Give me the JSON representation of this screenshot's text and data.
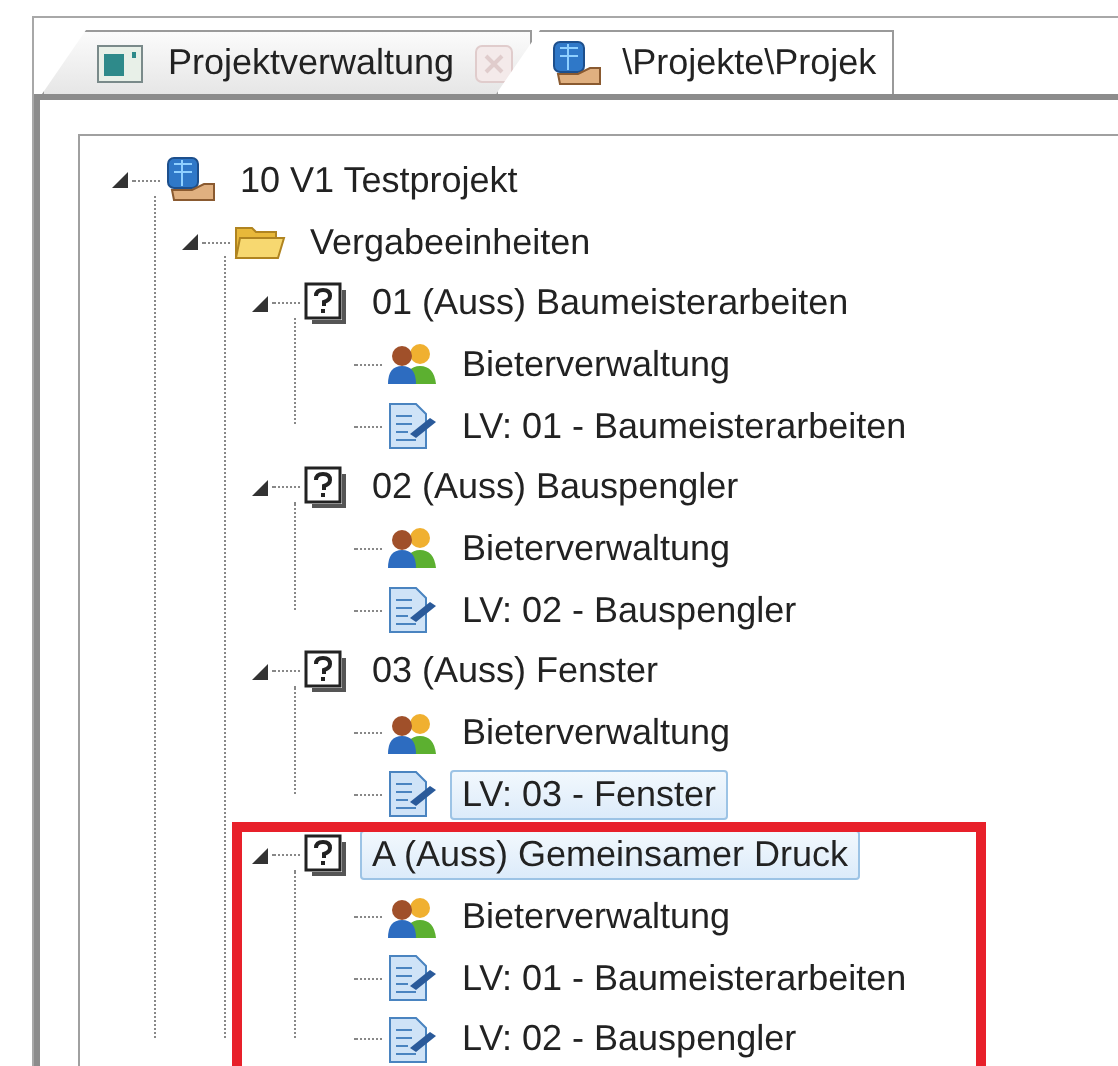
{
  "tabs": [
    {
      "label": "Projektverwaltung",
      "kind": "monitor",
      "selected": false,
      "closable": true
    },
    {
      "label": "\\Projekte\\Projek",
      "kind": "project",
      "selected": true,
      "closable": false
    }
  ],
  "tree": [
    {
      "label": "10 V1 Testprojekt",
      "kind": "project",
      "expanded": true,
      "selected": false,
      "highlighted": false,
      "children": [
        {
          "label": "Vergabeeinheiten",
          "kind": "folder",
          "expanded": true,
          "selected": false,
          "highlighted": false,
          "children": [
            {
              "label": "01 (Auss) Baumeisterarbeiten",
              "kind": "unit",
              "expanded": true,
              "selected": false,
              "highlighted": false,
              "children": [
                {
                  "label": "Bieterverwaltung",
                  "kind": "bidders",
                  "selected": false,
                  "highlighted": false
                },
                {
                  "label": "LV: 01 - Baumeisterarbeiten",
                  "kind": "lv",
                  "selected": false,
                  "highlighted": false
                }
              ]
            },
            {
              "label": "02 (Auss) Bauspengler",
              "kind": "unit",
              "expanded": true,
              "selected": false,
              "highlighted": false,
              "children": [
                {
                  "label": "Bieterverwaltung",
                  "kind": "bidders",
                  "selected": false,
                  "highlighted": false
                },
                {
                  "label": "LV: 02 - Bauspengler",
                  "kind": "lv",
                  "selected": false,
                  "highlighted": false
                }
              ]
            },
            {
              "label": "03 (Auss) Fenster",
              "kind": "unit",
              "expanded": true,
              "selected": false,
              "highlighted": false,
              "children": [
                {
                  "label": "Bieterverwaltung",
                  "kind": "bidders",
                  "selected": false,
                  "highlighted": false
                },
                {
                  "label": "LV: 03 - Fenster",
                  "kind": "lv",
                  "selected": true,
                  "highlighted": false
                }
              ]
            },
            {
              "label": "A (Auss) Gemeinsamer Druck",
              "kind": "unit",
              "expanded": true,
              "selected": true,
              "highlighted": true,
              "children": [
                {
                  "label": "Bieterverwaltung",
                  "kind": "bidders",
                  "selected": false,
                  "highlighted": false
                },
                {
                  "label": "LV: 01 - Baumeisterarbeiten",
                  "kind": "lv",
                  "selected": false,
                  "highlighted": false
                },
                {
                  "label": "LV: 02 - Bauspengler",
                  "kind": "lv",
                  "selected": false,
                  "highlighted": false
                }
              ]
            }
          ]
        }
      ]
    }
  ]
}
